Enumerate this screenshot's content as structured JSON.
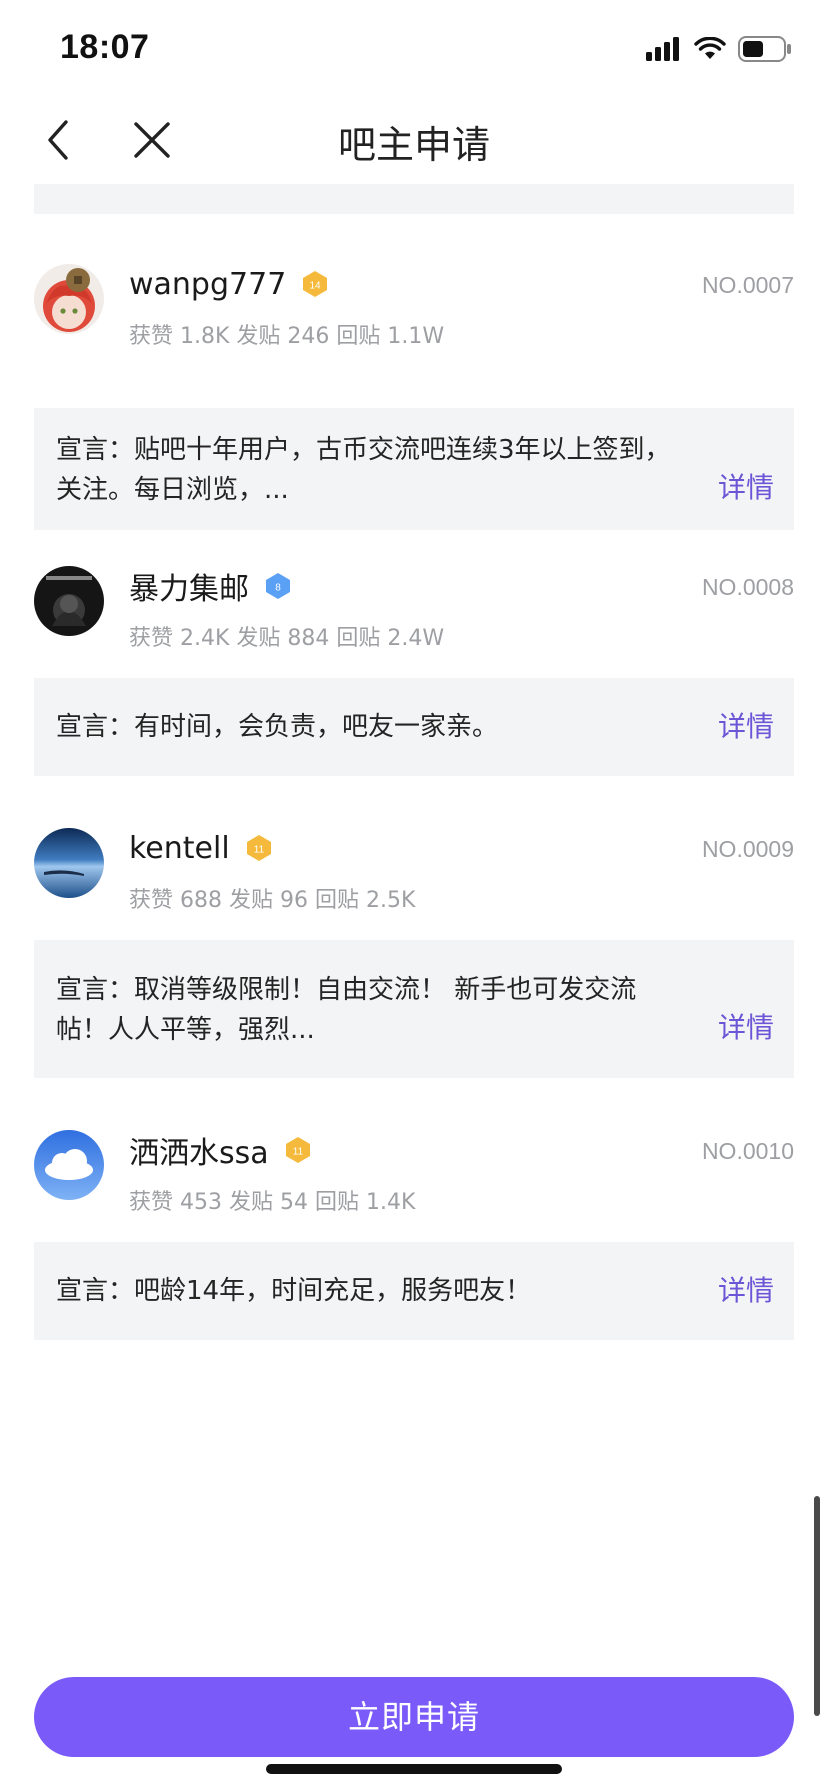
{
  "status_bar": {
    "time": "18:07"
  },
  "nav": {
    "title": "吧主申请",
    "back_icon": "chevron-left-icon",
    "close_icon": "close-icon"
  },
  "applicants": [
    {
      "name": "wanpg777",
      "level": "14",
      "badge_color": "#f5b93b",
      "badge_shape": "diamond",
      "number": "NO.0007",
      "stats": "获赞 1.8K 发贴 246 回贴 1.1W",
      "declaration": "宣言：贴吧十年用户，古币交流吧连续3年以上签到，关注。每日浏览，...",
      "detail_label": "详情"
    },
    {
      "name": "暴力集邮",
      "level": "8",
      "badge_color": "#5aa0f5",
      "badge_shape": "gem",
      "number": "NO.0008",
      "stats": "获赞 2.4K 发贴 884 回贴 2.4W",
      "declaration": "宣言：有时间，会负责，吧友一家亲。",
      "detail_label": "详情"
    },
    {
      "name": "kentell",
      "level": "11",
      "badge_color": "#f5b93b",
      "badge_shape": "diamond",
      "number": "NO.0009",
      "stats": "获赞 688 发贴 96 回贴 2.5K",
      "declaration": "宣言：取消等级限制！自由交流！ 新手也可发交流帖！人人平等，强烈...",
      "detail_label": "详情"
    },
    {
      "name": "洒洒水ssa",
      "level": "11",
      "badge_color": "#f5b93b",
      "badge_shape": "diamond",
      "number": "NO.0010",
      "stats": "获赞 453 发贴 54 回贴 1.4K",
      "declaration": "宣言：吧龄14年，时间充足，服务吧友！",
      "detail_label": "详情"
    }
  ],
  "apply_button": {
    "label": "立即申请",
    "color": "#7a5af8"
  },
  "colors": {
    "accent": "#6c55d6",
    "card_bg": "#f3f4f5",
    "muted_text": "#9d9fa3"
  }
}
